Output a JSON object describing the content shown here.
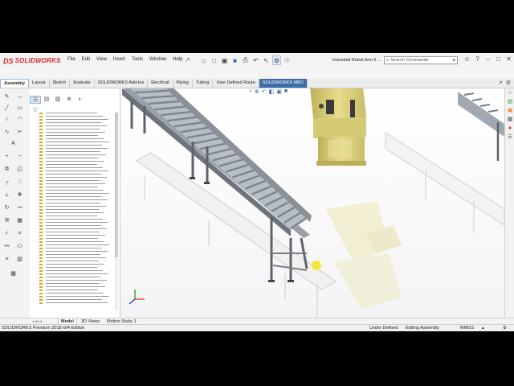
{
  "app": {
    "logo_mark": "DS",
    "logo_text": "SOLIDWORKS"
  },
  "menu": [
    "File",
    "Edit",
    "View",
    "Insert",
    "Tools",
    "Window",
    "Help"
  ],
  "document_title": "Industrial Robot Arm 6 ...",
  "search": {
    "placeholder": "Search Commands"
  },
  "command_tabs": [
    "Assembly",
    "Layout",
    "Sketch",
    "Evaluate",
    "SOLIDWORKS Add-Ins",
    "Electrical",
    "Piping",
    "Tubing",
    "User Defined Route",
    "SOLIDWORKS MBD"
  ],
  "active_command_tab": "Assembly",
  "bottom_tabs": [
    "Model",
    "3D Views",
    "Motion Study 1"
  ],
  "active_bottom_tab": "Model",
  "status": {
    "edition": "SOLIDWORKS Premium 2018 x64 Edition",
    "definition": "Under Defined",
    "mode": "Editing Assembly",
    "units": "MMGS"
  },
  "icons": {
    "quick_access": [
      "home-icon",
      "new-icon",
      "open-icon",
      "save-icon",
      "print-icon",
      "undo-icon",
      "select-icon",
      "rebuild-icon",
      "options-icon"
    ],
    "tree_tabs": [
      "feature-manager-icon",
      "property-manager-icon",
      "configuration-manager-icon",
      "dimxpert-icon",
      "display-manager-icon"
    ],
    "task_pane": [
      "home-icon",
      "design-library-icon",
      "file-explorer-icon",
      "view-palette-icon",
      "appearances-icon",
      "custom-properties-icon"
    ]
  },
  "colors": {
    "brand_red": "#d8262e",
    "accent_blue": "#3d6fa6",
    "robot_yellow": "#d9cf7a",
    "tree_icon_orange": "#e3a020"
  }
}
